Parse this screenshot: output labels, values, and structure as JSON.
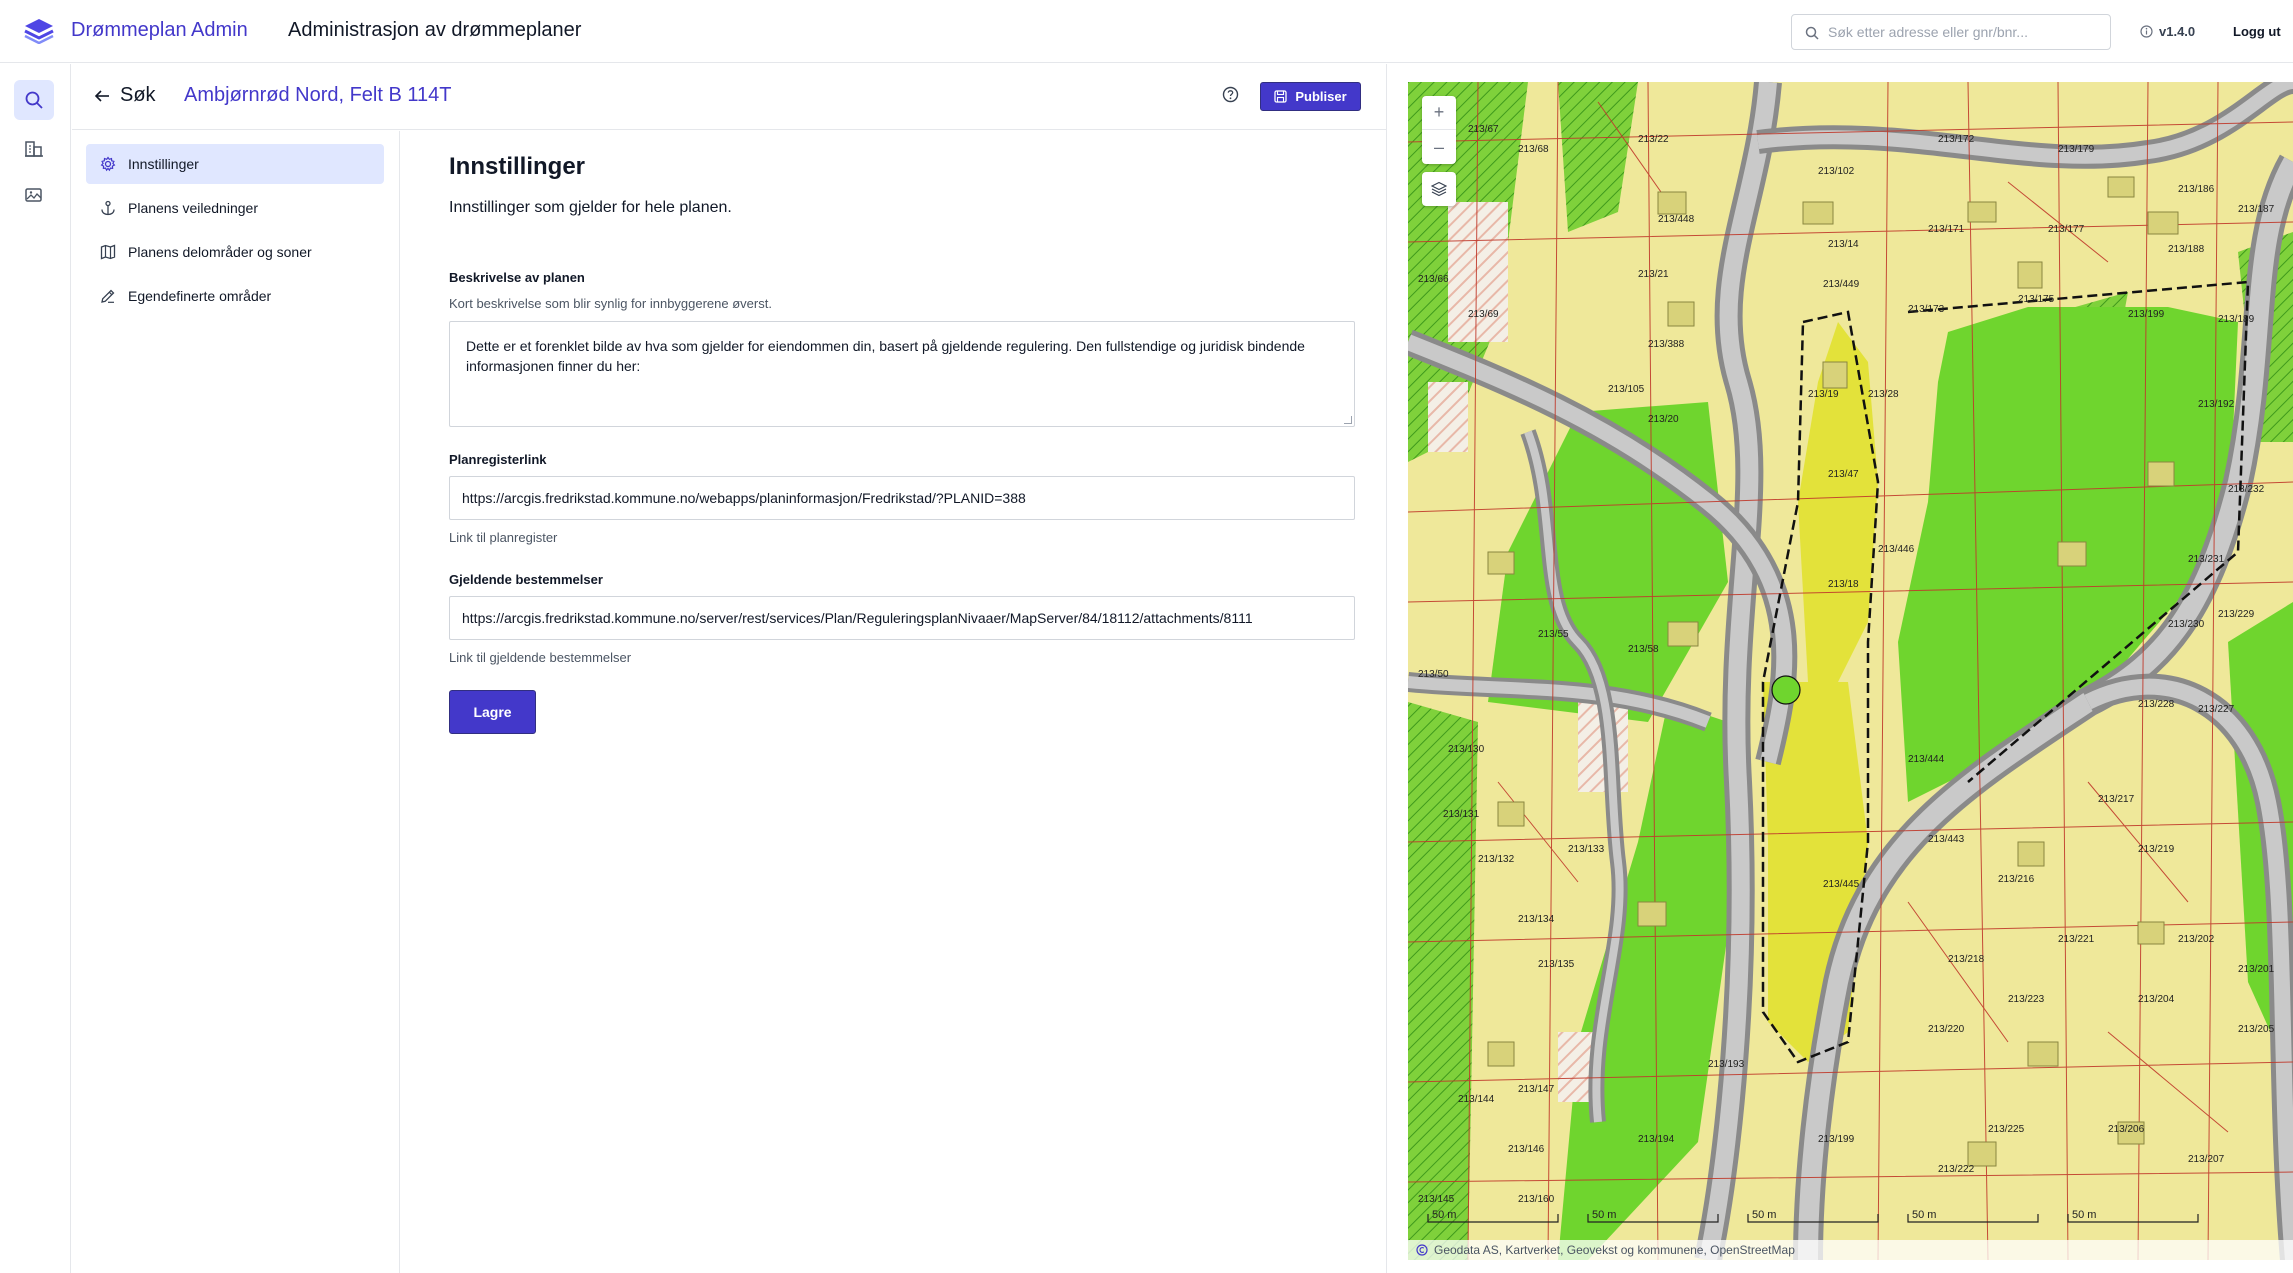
{
  "header": {
    "brand_name": "Drømmeplan Admin",
    "title": "Administrasjon av drømmeplaner",
    "search_placeholder": "Søk etter adresse eller gnr/bnr...",
    "version": "v1.4.0",
    "logout_label": "Logg ut"
  },
  "rail": {
    "items": [
      {
        "icon": "search-icon",
        "active": true
      },
      {
        "icon": "building-icon",
        "active": false
      },
      {
        "icon": "image-icon",
        "active": false
      }
    ]
  },
  "page": {
    "back_label": "Søk",
    "plan_title": "Ambjørnrød Nord, Felt B 114T",
    "publish_label": "Publiser"
  },
  "settings_nav": {
    "items": [
      {
        "label": "Innstillinger",
        "icon": "gear-icon",
        "active": true
      },
      {
        "label": "Planens veiledninger",
        "icon": "anchor-icon",
        "active": false
      },
      {
        "label": "Planens delområder og soner",
        "icon": "map-icon",
        "active": false
      },
      {
        "label": "Egendefinerte områder",
        "icon": "pencil-icon",
        "active": false
      }
    ]
  },
  "settings": {
    "heading": "Innstillinger",
    "lead": "Innstillinger som gjelder for hele planen.",
    "description": {
      "label": "Beskrivelse av planen",
      "hint": "Kort beskrivelse som blir synlig for innbyggerene øverst.",
      "value": "Dette er et forenklet bilde av hva som gjelder for eiendommen din, basert på gjeldende regulering. Den fullstendige og juridisk bindende informasjonen finner du her:"
    },
    "plan_register": {
      "label": "Planregisterlink",
      "value": "https://arcgis.fredrikstad.kommune.no/webapps/planinformasjon/Fredrikstad/?PLANID=388",
      "hint": "Link til planregister"
    },
    "regulations": {
      "label": "Gjeldende bestemmelser",
      "value": "https://arcgis.fredrikstad.kommune.no/server/rest/services/Plan/ReguleringsplanNivaaer/MapServer/84/18112/attachments/8111",
      "hint": "Link til gjeldende bestemmelser"
    },
    "save_label": "Lagre"
  },
  "map": {
    "zoom_in": "+",
    "zoom_out": "–",
    "attribution": "Geodata AS, Kartverket, Geovekst og kommunene, OpenStreetMap",
    "scale_labels": [
      "50 m",
      "50 m",
      "50 m",
      "50 m",
      "50 m"
    ],
    "parcel_labels": [
      "213/67",
      "213/68",
      "213/22",
      "213/102",
      "213/172",
      "213/179",
      "213/186",
      "213/187",
      "213/448",
      "213/14",
      "213/171",
      "213/177",
      "213/188",
      "213/66",
      "213/69",
      "213/21",
      "213/449",
      "213/173",
      "213/175",
      "213/199",
      "213/189",
      "213/388",
      "213/19",
      "213/28",
      "213/105",
      "213/20",
      "213/192",
      "213/47",
      "213/446",
      "213/232",
      "213/231",
      "213/18",
      "213/230",
      "213/229",
      "213/50",
      "213/55",
      "213/58",
      "213/228",
      "213/227",
      "213/444",
      "213/130",
      "213/131",
      "213/132",
      "213/133",
      "213/217",
      "213/443",
      "213/219",
      "213/216",
      "213/445",
      "213/134",
      "213/135",
      "213/221",
      "213/202",
      "213/201",
      "213/218",
      "213/223",
      "213/204",
      "213/220",
      "213/205",
      "213/193",
      "213/144",
      "213/147",
      "213/225",
      "213/206",
      "213/194",
      "213/199",
      "213/146",
      "213/222",
      "213/207",
      "213/145",
      "213/160"
    ]
  }
}
